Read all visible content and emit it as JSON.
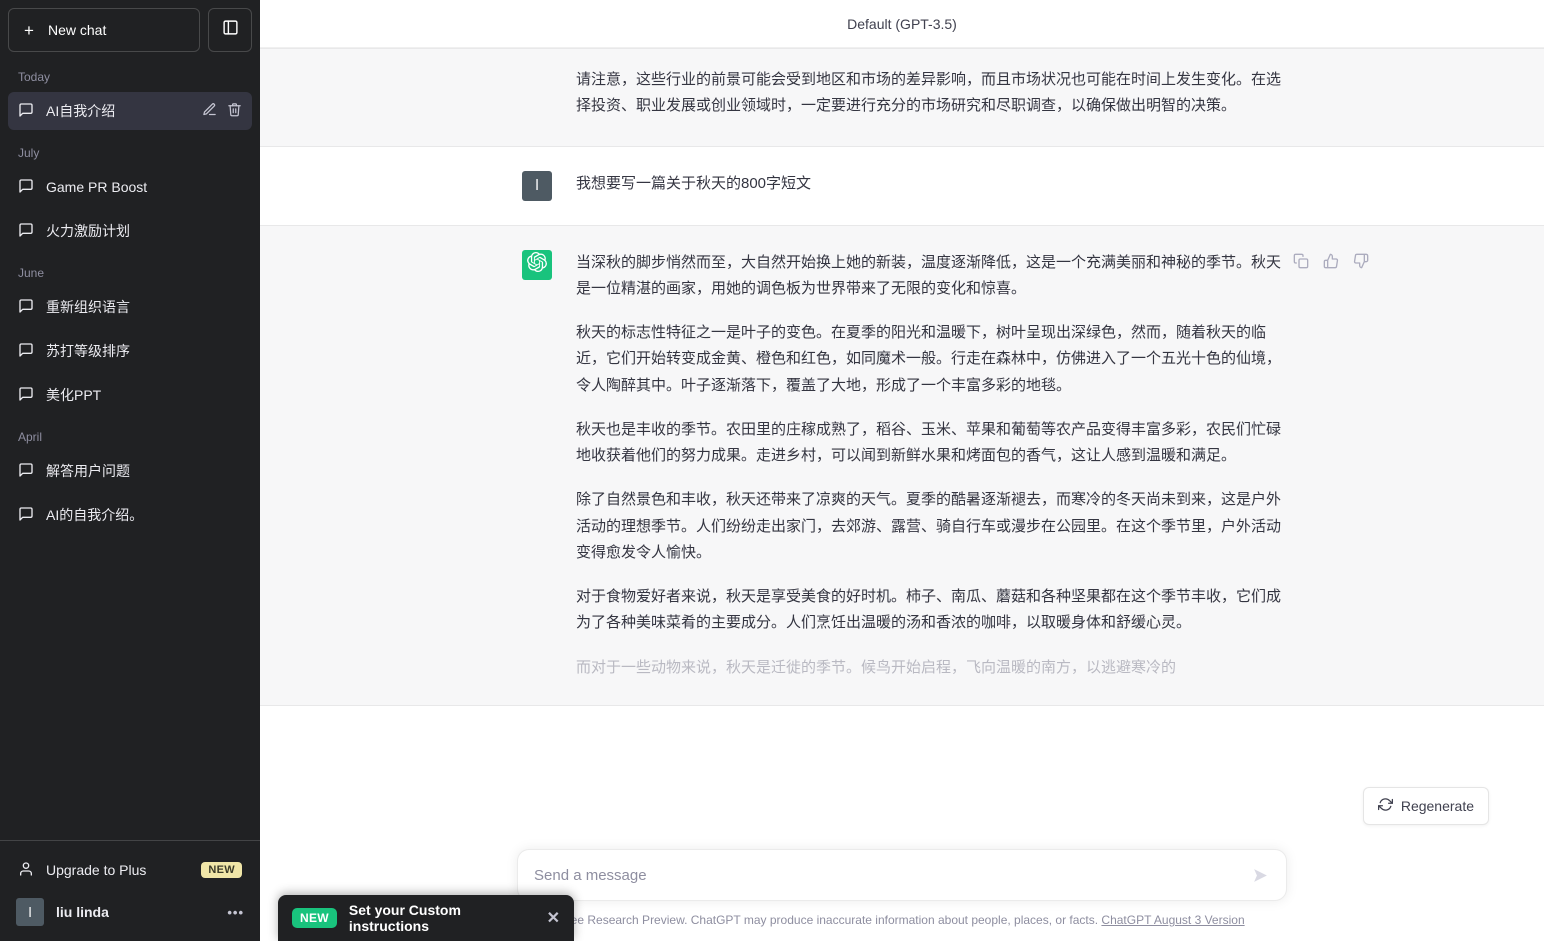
{
  "sidebar": {
    "new_chat_label": "New chat",
    "new_chat_icon": "plus-icon",
    "panel_toggle_icon": "sidebar-panel-icon",
    "groups": [
      {
        "date_label": "Today",
        "items": [
          {
            "title": "AI自我介绍",
            "active": true,
            "icon": "chat-bubble-icon",
            "edit_icon": "pencil-icon",
            "delete_icon": "trash-icon"
          }
        ]
      },
      {
        "date_label": "July",
        "items": [
          {
            "title": "Game PR Boost",
            "active": false,
            "icon": "chat-bubble-icon"
          },
          {
            "title": "火力激励计划",
            "active": false,
            "icon": "chat-bubble-icon"
          }
        ]
      },
      {
        "date_label": "June",
        "items": [
          {
            "title": "重新组织语言",
            "active": false,
            "icon": "chat-bubble-icon"
          },
          {
            "title": "苏打等级排序",
            "active": false,
            "icon": "chat-bubble-icon"
          },
          {
            "title": "美化PPT",
            "active": false,
            "icon": "chat-bubble-icon"
          }
        ]
      },
      {
        "date_label": "April",
        "items": [
          {
            "title": "解答用户问题",
            "active": false,
            "icon": "chat-bubble-icon"
          },
          {
            "title": "AI的自我介绍。",
            "active": false,
            "icon": "chat-bubble-icon"
          }
        ]
      }
    ],
    "upgrade": {
      "label": "Upgrade to Plus",
      "badge": "NEW",
      "icon": "person-icon"
    },
    "user": {
      "name": "liu linda",
      "avatar_letter": "l",
      "menu_icon": "ellipsis-icon"
    }
  },
  "header": {
    "model_label": "Default (GPT-3.5)"
  },
  "messages": [
    {
      "role": "assistant",
      "avatar": "openai-logo-icon",
      "paragraphs": [
        "请注意，这些行业的前景可能会受到地区和市场的差异影响，而且市场状况也可能在时间上发生变化。在选择投资、职业发展或创业领域时，一定要进行充分的市场研究和尽职调查，以确保做出明智的决策。"
      ]
    },
    {
      "role": "user",
      "avatar_letter": "l",
      "paragraphs": [
        "我想要写一篇关于秋天的800字短文"
      ]
    },
    {
      "role": "assistant",
      "avatar": "openai-logo-icon",
      "paragraphs": [
        "当深秋的脚步悄然而至，大自然开始换上她的新装，温度逐渐降低，这是一个充满美丽和神秘的季节。秋天是一位精湛的画家，用她的调色板为世界带来了无限的变化和惊喜。",
        "秋天的标志性特征之一是叶子的变色。在夏季的阳光和温暖下，树叶呈现出深绿色，然而，随着秋天的临近，它们开始转变成金黄、橙色和红色，如同魔术一般。行走在森林中，仿佛进入了一个五光十色的仙境，令人陶醉其中。叶子逐渐落下，覆盖了大地，形成了一个丰富多彩的地毯。",
        "秋天也是丰收的季节。农田里的庄稼成熟了，稻谷、玉米、苹果和葡萄等农产品变得丰富多彩，农民们忙碌地收获着他们的努力成果。走进乡村，可以闻到新鲜水果和烤面包的香气，这让人感到温暖和满足。",
        "除了自然景色和丰收，秋天还带来了凉爽的天气。夏季的酷暑逐渐褪去，而寒冷的冬天尚未到来，这是户外活动的理想季节。人们纷纷走出家门，去郊游、露营、骑自行车或漫步在公园里。在这个季节里，户外活动变得愈发令人愉快。",
        "对于食物爱好者来说，秋天是享受美食的好时机。柿子、南瓜、蘑菇和各种坚果都在这个季节丰收，它们成为了各种美味菜肴的主要成分。人们烹饪出温暖的汤和香浓的咖啡，以取暖身体和舒缓心灵。",
        "而对于一些动物来说，秋天是迁徙的季节。候鸟开始启程，飞向温暖的南方，以逃避寒冷的"
      ],
      "actions": [
        {
          "name": "copy-icon"
        },
        {
          "name": "thumbs-up-icon"
        },
        {
          "name": "thumbs-down-icon"
        }
      ]
    }
  ],
  "composer": {
    "placeholder": "Send a message",
    "value": "",
    "send_icon": "send-arrow-icon",
    "regenerate_label": "Regenerate",
    "regenerate_icon": "refresh-icon"
  },
  "footer": {
    "note": "Free Research Preview. ChatGPT may produce inaccurate information about people, places, or facts.",
    "link": "ChatGPT August 3 Version"
  },
  "toast": {
    "badge": "NEW",
    "label": "Set your Custom instructions",
    "close_icon": "close-icon"
  },
  "colors": {
    "sidebar_bg": "#202123",
    "sidebar_active": "#343541",
    "assistant_row_bg": "#f7f7f8",
    "user_row_bg": "#ffffff",
    "brand_green": "#19c37d",
    "badge_yellow": "#f0e6a8",
    "text_primary": "#343541",
    "text_muted": "#8e8ea0"
  }
}
